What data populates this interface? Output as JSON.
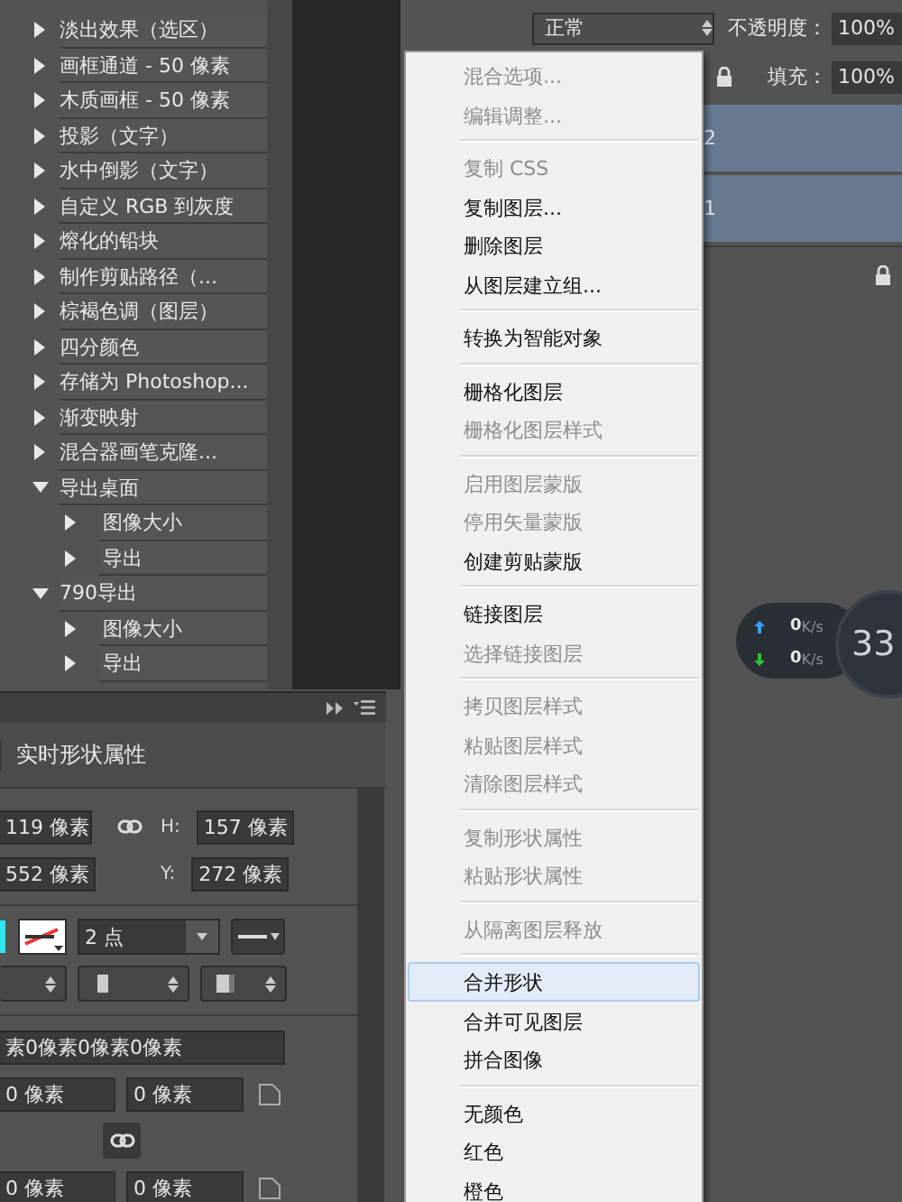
{
  "actions_panel": {
    "items": [
      {
        "label": "淡出效果（选区）",
        "expanded": false
      },
      {
        "label": "画框通道 - 50 像素",
        "expanded": false
      },
      {
        "label": "木质画框 - 50 像素",
        "expanded": false
      },
      {
        "label": "投影（文字）",
        "expanded": false
      },
      {
        "label": "水中倒影（文字）",
        "expanded": false
      },
      {
        "label": "自定义 RGB 到灰度",
        "expanded": false
      },
      {
        "label": "熔化的铅块",
        "expanded": false
      },
      {
        "label": "制作剪贴路径（...",
        "expanded": false
      },
      {
        "label": "棕褐色调（图层）",
        "expanded": false
      },
      {
        "label": "四分颜色",
        "expanded": false
      },
      {
        "label": "存储为 Photoshop...",
        "expanded": false
      },
      {
        "label": "渐变映射",
        "expanded": false
      },
      {
        "label": "混合器画笔克隆...",
        "expanded": false
      },
      {
        "label": "导出桌面",
        "expanded": true,
        "children": [
          {
            "label": "图像大小",
            "expanded": false
          },
          {
            "label": "导出",
            "expanded": false
          }
        ]
      },
      {
        "label": "790导出",
        "expanded": true,
        "children": [
          {
            "label": "图像大小",
            "expanded": false
          },
          {
            "label": "导出",
            "expanded": false
          }
        ]
      }
    ]
  },
  "properties_panel": {
    "title": "实时形状属性",
    "w": "119 像素",
    "h_label": "H:",
    "h": "157 像素",
    "x": "552 像素",
    "y_label": "Y:",
    "y": "272 像素",
    "stroke_width": "2 点",
    "corner_radii": "素0像素0像素0像素",
    "corners": [
      "0 像素",
      "0 像素",
      "0 像素",
      "0 像素"
    ]
  },
  "layers_panel": {
    "blend_mode": "正常",
    "opacity_label": "不透明度：",
    "opacity": "100%",
    "fill_label": "填充：",
    "fill": "100%",
    "layers": [
      {
        "label": "2",
        "selected": true
      },
      {
        "label": "1",
        "selected": true
      }
    ]
  },
  "network_widget": {
    "upload": "0",
    "upload_unit": "K/s",
    "download": "0",
    "download_unit": "K/s",
    "value": "33"
  },
  "context_menu": {
    "groups": [
      [
        {
          "label": "混合选项...",
          "disabled": true,
          "selected": false
        },
        {
          "label": "编辑调整...",
          "disabled": true,
          "selected": false
        }
      ],
      [
        {
          "label": "复制 CSS",
          "disabled": true,
          "selected": false
        },
        {
          "label": "复制图层...",
          "disabled": false,
          "selected": false
        },
        {
          "label": "删除图层",
          "disabled": false,
          "selected": false
        },
        {
          "label": "从图层建立组...",
          "disabled": false,
          "selected": false
        }
      ],
      [
        {
          "label": "转换为智能对象",
          "disabled": false,
          "selected": false
        }
      ],
      [
        {
          "label": "栅格化图层",
          "disabled": false,
          "selected": false
        },
        {
          "label": "栅格化图层样式",
          "disabled": true,
          "selected": false
        }
      ],
      [
        {
          "label": "启用图层蒙版",
          "disabled": true,
          "selected": false
        },
        {
          "label": "停用矢量蒙版",
          "disabled": true,
          "selected": false
        },
        {
          "label": "创建剪贴蒙版",
          "disabled": false,
          "selected": false
        }
      ],
      [
        {
          "label": "链接图层",
          "disabled": false,
          "selected": false
        },
        {
          "label": "选择链接图层",
          "disabled": true,
          "selected": false
        }
      ],
      [
        {
          "label": "拷贝图层样式",
          "disabled": true,
          "selected": false
        },
        {
          "label": "粘贴图层样式",
          "disabled": true,
          "selected": false
        },
        {
          "label": "清除图层样式",
          "disabled": true,
          "selected": false
        }
      ],
      [
        {
          "label": "复制形状属性",
          "disabled": true,
          "selected": false
        },
        {
          "label": "粘贴形状属性",
          "disabled": true,
          "selected": false
        }
      ],
      [
        {
          "label": "从隔离图层释放",
          "disabled": true,
          "selected": false
        }
      ],
      [
        {
          "label": "合并形状",
          "disabled": false,
          "selected": true
        },
        {
          "label": "合并可见图层",
          "disabled": false,
          "selected": false
        },
        {
          "label": "拼合图像",
          "disabled": false,
          "selected": false
        }
      ],
      [
        {
          "label": "无颜色",
          "disabled": false,
          "selected": false
        },
        {
          "label": "红色",
          "disabled": false,
          "selected": false
        },
        {
          "label": "橙色",
          "disabled": false,
          "selected": false
        }
      ]
    ]
  }
}
